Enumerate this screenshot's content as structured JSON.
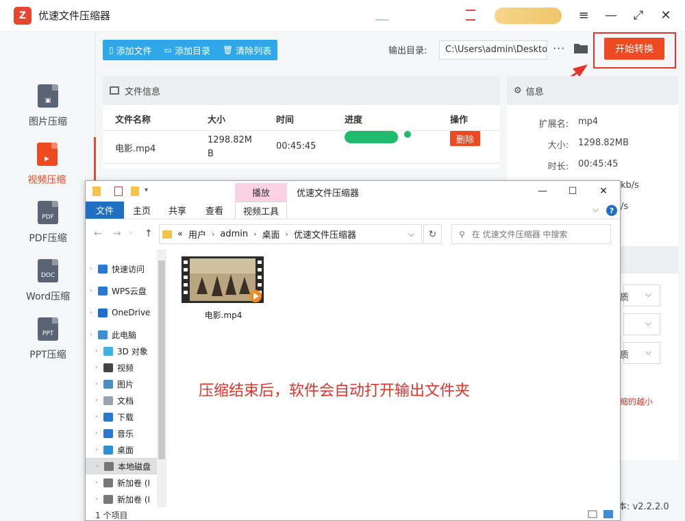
{
  "app": {
    "title": "优速文件压缩器",
    "logo": "Z"
  },
  "sidebar": {
    "items": [
      {
        "label": "图片压缩",
        "icon": "image-file-icon",
        "badge": ""
      },
      {
        "label": "视频压缩",
        "icon": "video-file-icon",
        "badge": ""
      },
      {
        "label": "PDF压缩",
        "icon": "pdf-file-icon",
        "badge": "PDF"
      },
      {
        "label": "Word压缩",
        "icon": "doc-file-icon",
        "badge": "DOC"
      },
      {
        "label": "PPT压缩",
        "icon": "ppt-file-icon",
        "badge": "PPT"
      }
    ],
    "active": "视频压缩"
  },
  "toolbar": {
    "add_file": "添加文件",
    "add_dir": "添加目录",
    "clear_list": "清除列表",
    "output_label": "输出目录:",
    "output_path": "C:\\Users\\admin\\Deskto",
    "more": "···",
    "start": "开始转换"
  },
  "file_panel": {
    "title": "文件信息",
    "columns": [
      "文件名称",
      "大小",
      "时间",
      "进度",
      "操作"
    ],
    "rows": [
      {
        "name": "电影.mp4",
        "size_line1": "1298.82M",
        "size_line2": "B",
        "time": "00:45:45",
        "progress": 1.0,
        "action": "删除"
      }
    ]
  },
  "info_panel": {
    "title": "信息",
    "rows": [
      {
        "key": "扩展名:",
        "value": "mp4"
      },
      {
        "key": "大小:",
        "value": "1298.82MB"
      },
      {
        "key": "时长:",
        "value": "00:45:45"
      },
      {
        "key": "",
        "value": "kb/s"
      },
      {
        "key": "",
        "value": "/s"
      }
    ],
    "selects": [
      "质",
      "",
      "质"
    ],
    "note": "缩的越小",
    "version_label": "本:",
    "version": "v2.2.2.0"
  },
  "explorer": {
    "context_tab": "播放",
    "title": "优速文件压缩器",
    "tabs": [
      "文件",
      "主页",
      "共享",
      "查看",
      "视频工具"
    ],
    "breadcrumb": [
      "«",
      "用户",
      "admin",
      "桌面",
      "优速文件压缩器"
    ],
    "search_placeholder": "在 优速文件压缩器 中搜索",
    "nav": [
      {
        "label": "快速访问",
        "icon": "star-icon",
        "color": "#2b78d4"
      },
      {
        "label": "WPS云盘",
        "icon": "cloud-icon",
        "color": "#2b78d4"
      },
      {
        "label": "OneDrive",
        "icon": "onedrive-icon",
        "color": "#1a6fd1"
      },
      {
        "label": "此电脑",
        "icon": "computer-icon",
        "color": "#3c8fd6"
      },
      {
        "label": "3D 对象",
        "icon": "cube-icon",
        "color": "#3bb3e6"
      },
      {
        "label": "视频",
        "icon": "film-icon",
        "color": "#444444"
      },
      {
        "label": "图片",
        "icon": "picture-icon",
        "color": "#4a90c8"
      },
      {
        "label": "文档",
        "icon": "document-icon",
        "color": "#9aa3ad"
      },
      {
        "label": "下载",
        "icon": "download-icon",
        "color": "#2b78d4"
      },
      {
        "label": "音乐",
        "icon": "music-icon",
        "color": "#2b78d4"
      },
      {
        "label": "桌面",
        "icon": "desktop-icon",
        "color": "#2b8fd9"
      },
      {
        "label": "本地磁盘",
        "icon": "drive-icon",
        "color": "#777777"
      },
      {
        "label": "新加卷 (I",
        "icon": "drive-icon",
        "color": "#777777"
      },
      {
        "label": "新加卷 (I",
        "icon": "drive-icon",
        "color": "#777777"
      }
    ],
    "file": {
      "name": "电影.mp4"
    },
    "overlay": "压缩结束后，软件会自动打开输出文件夹",
    "status": "1 个项目"
  },
  "colors": {
    "accent": "#ee4a22",
    "blue": "#2ea8e8",
    "progress": "#1fba6a"
  }
}
